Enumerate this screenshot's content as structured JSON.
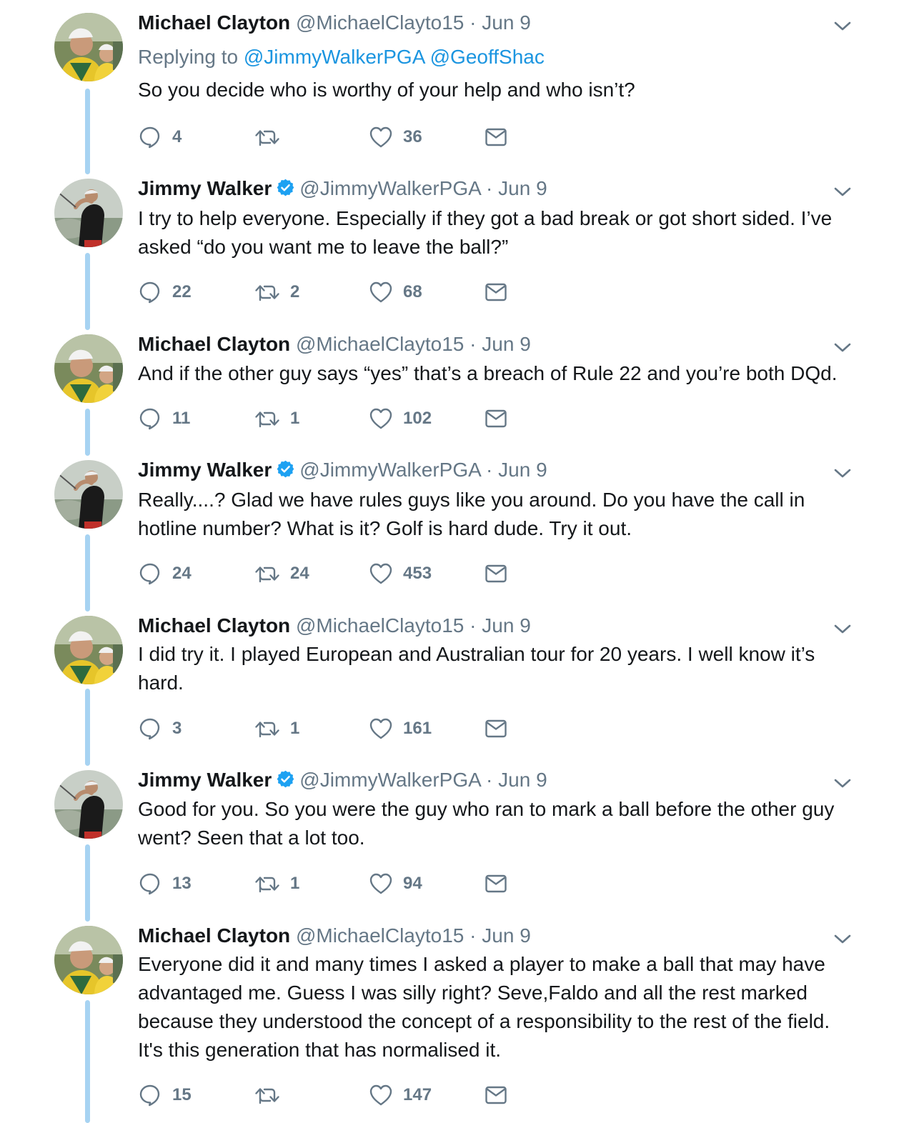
{
  "tweets": [
    {
      "author": "michael",
      "name": "Michael Clayton",
      "handle": "@MichaelClayto15",
      "date": "Jun 9",
      "replying_label": "Replying to",
      "replying_to": [
        "@JimmyWalkerPGA",
        "@GeoffShac"
      ],
      "text": "So you decide who is worthy of your help and who isn’t?",
      "replies": "4",
      "retweets": "",
      "likes": "36"
    },
    {
      "author": "jimmy",
      "name": "Jimmy Walker",
      "verified": true,
      "handle": "@JimmyWalkerPGA",
      "date": "Jun 9",
      "text": "I try to help everyone. Especially if they got a bad break or got short sided. I’ve asked “do you want me to leave the ball?”",
      "replies": "22",
      "retweets": "2",
      "likes": "68"
    },
    {
      "author": "michael",
      "name": "Michael Clayton",
      "handle": "@MichaelClayto15",
      "date": "Jun 9",
      "text": "And if the other guy says “yes” that’s a breach of Rule 22 and you’re both DQd.",
      "replies": "11",
      "retweets": "1",
      "likes": "102"
    },
    {
      "author": "jimmy",
      "name": "Jimmy Walker",
      "verified": true,
      "handle": "@JimmyWalkerPGA",
      "date": "Jun 9",
      "text": "Really....? Glad we have rules guys like you around. Do you have the call in hotline number? What is it? Golf is hard dude. Try it out.",
      "replies": "24",
      "retweets": "24",
      "likes": "453"
    },
    {
      "author": "michael",
      "name": "Michael Clayton",
      "handle": "@MichaelClayto15",
      "date": "Jun 9",
      "text": "I did try it. I played European and Australian tour for 20 years. I well know it’s hard.",
      "replies": "3",
      "retweets": "1",
      "likes": "161"
    },
    {
      "author": "jimmy",
      "name": "Jimmy Walker",
      "verified": true,
      "handle": "@JimmyWalkerPGA",
      "date": "Jun 9",
      "text": "Good for you. So you were the guy who ran to mark a ball before the other guy went?  Seen that a lot too.",
      "replies": "13",
      "retweets": "1",
      "likes": "94"
    },
    {
      "author": "michael",
      "name": "Michael Clayton",
      "handle": "@MichaelClayto15",
      "date": "Jun 9",
      "text": "Everyone did it and many times I asked a player to make a ball that may have advantaged me. Guess I was silly right?  Seve,Faldo and all the rest marked because they understood the concept of a responsibility to the rest of the field. It's this generation that has normalised it.",
      "replies": "15",
      "retweets": "",
      "likes": "147"
    }
  ],
  "separator": "·",
  "icons": {
    "reply": "reply-icon",
    "retweet": "retweet-icon",
    "like": "heart-icon",
    "dm": "envelope-icon",
    "caret": "chevron-down-icon",
    "verified": "verified-badge-icon"
  },
  "colors": {
    "text": "#14171a",
    "secondary": "#657786",
    "link": "#1b95e0",
    "thread_line": "#a7d3f2",
    "verified": "#1da1f2"
  }
}
